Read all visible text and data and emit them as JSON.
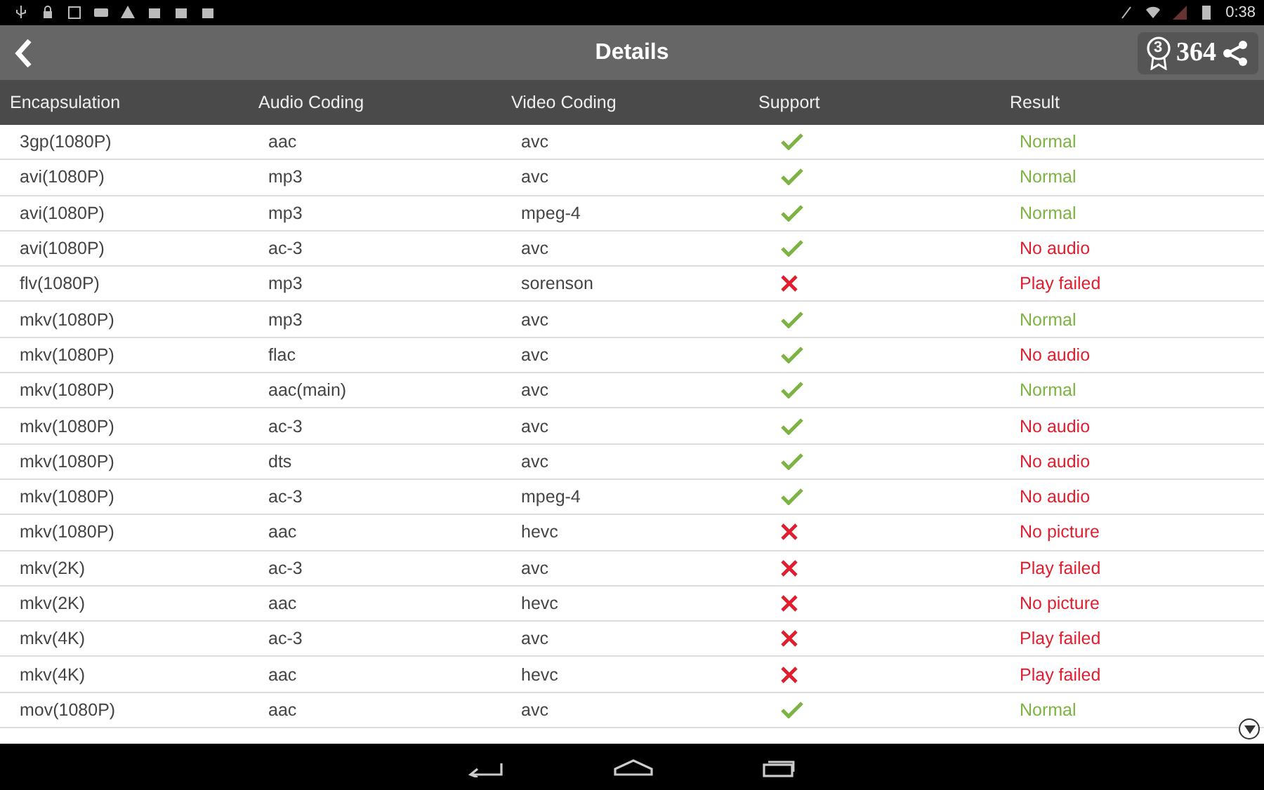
{
  "status_bar": {
    "time": "0:38"
  },
  "header": {
    "title": "Details",
    "rank": "3",
    "score": "364"
  },
  "table": {
    "columns": [
      "Encapsulation",
      "Audio Coding",
      "Video Coding",
      "Support",
      "Result"
    ],
    "rows": [
      {
        "encapsulation": "3gp(1080P)",
        "audio": "aac",
        "video": "avc",
        "supported": true,
        "result": "Normal",
        "ok": true
      },
      {
        "encapsulation": "avi(1080P)",
        "audio": "mp3",
        "video": "avc",
        "supported": true,
        "result": "Normal",
        "ok": true
      },
      {
        "encapsulation": "avi(1080P)",
        "audio": "mp3",
        "video": "mpeg-4",
        "supported": true,
        "result": "Normal",
        "ok": true
      },
      {
        "encapsulation": "avi(1080P)",
        "audio": "ac-3",
        "video": "avc",
        "supported": true,
        "result": "No audio",
        "ok": false
      },
      {
        "encapsulation": "flv(1080P)",
        "audio": "mp3",
        "video": "sorenson",
        "supported": false,
        "result": "Play failed",
        "ok": false
      },
      {
        "encapsulation": "mkv(1080P)",
        "audio": "mp3",
        "video": "avc",
        "supported": true,
        "result": "Normal",
        "ok": true
      },
      {
        "encapsulation": "mkv(1080P)",
        "audio": "flac",
        "video": "avc",
        "supported": true,
        "result": "No audio",
        "ok": false
      },
      {
        "encapsulation": "mkv(1080P)",
        "audio": "aac(main)",
        "video": "avc",
        "supported": true,
        "result": "Normal",
        "ok": true
      },
      {
        "encapsulation": "mkv(1080P)",
        "audio": "ac-3",
        "video": "avc",
        "supported": true,
        "result": "No audio",
        "ok": false
      },
      {
        "encapsulation": "mkv(1080P)",
        "audio": "dts",
        "video": "avc",
        "supported": true,
        "result": "No audio",
        "ok": false
      },
      {
        "encapsulation": "mkv(1080P)",
        "audio": "ac-3",
        "video": "mpeg-4",
        "supported": true,
        "result": "No audio",
        "ok": false
      },
      {
        "encapsulation": "mkv(1080P)",
        "audio": "aac",
        "video": "hevc",
        "supported": false,
        "result": "No picture",
        "ok": false
      },
      {
        "encapsulation": "mkv(2K)",
        "audio": "ac-3",
        "video": "avc",
        "supported": false,
        "result": "Play failed",
        "ok": false
      },
      {
        "encapsulation": "mkv(2K)",
        "audio": "aac",
        "video": "hevc",
        "supported": false,
        "result": "No picture",
        "ok": false
      },
      {
        "encapsulation": "mkv(4K)",
        "audio": "ac-3",
        "video": "avc",
        "supported": false,
        "result": "Play failed",
        "ok": false
      },
      {
        "encapsulation": "mkv(4K)",
        "audio": "aac",
        "video": "hevc",
        "supported": false,
        "result": "Play failed",
        "ok": false
      },
      {
        "encapsulation": "mov(1080P)",
        "audio": "aac",
        "video": "avc",
        "supported": true,
        "result": "Normal",
        "ok": true
      }
    ]
  }
}
